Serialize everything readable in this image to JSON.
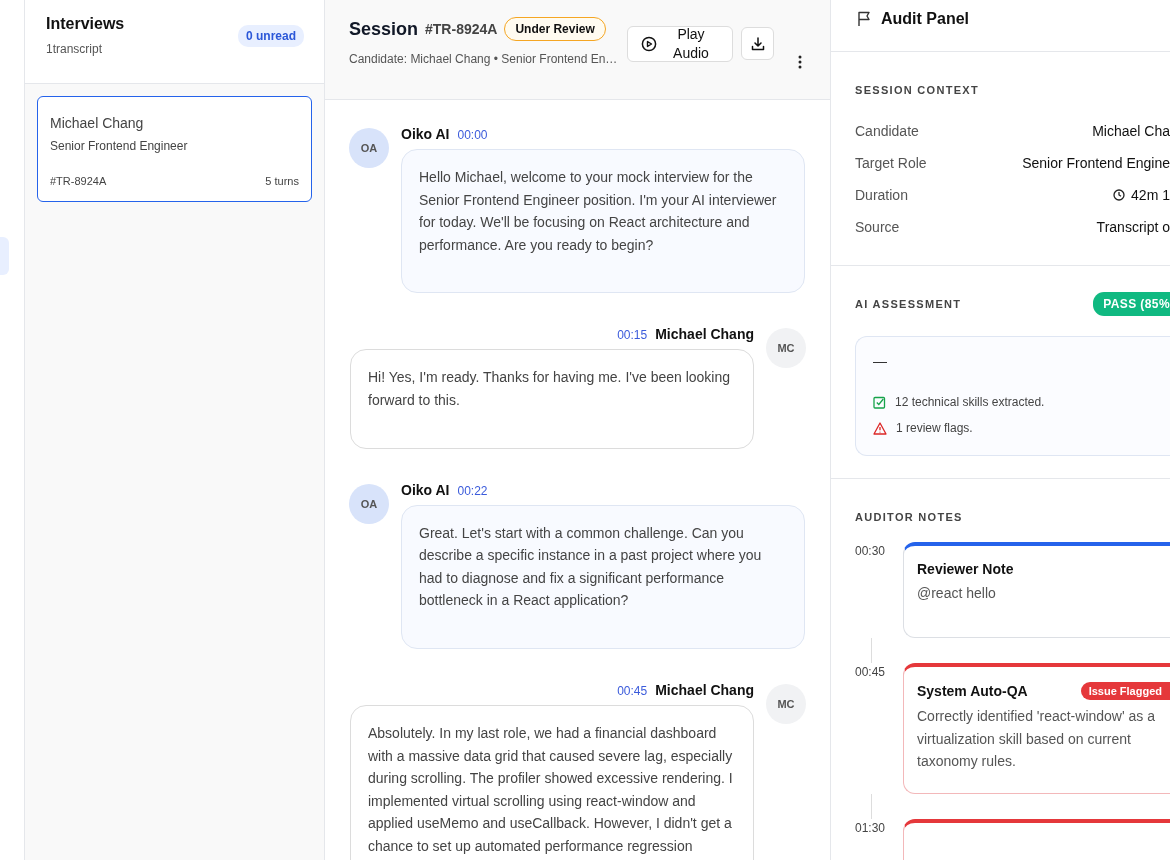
{
  "sidebar": {
    "title": "Interviews",
    "subtitle": "1transcript",
    "unread": "0 unread",
    "items": [
      {
        "name": "Michael Chang",
        "role": "Senior Frontend Engineer",
        "id": "#TR-8924A",
        "turns": "5 turns",
        "selected": true
      }
    ]
  },
  "session": {
    "title": "Session",
    "id": "#TR-8924A",
    "status": "Under Review",
    "subtitle": "Candidate: Michael Chang • Senior Frontend En…",
    "play_button": "Play Audio"
  },
  "messages": [
    {
      "kind": "ai",
      "speaker": "Oiko AI",
      "time": "00:00",
      "initials": "OA",
      "text": "Hello Michael, welcome to your mock interview for the Senior Frontend Engineer position. I'm your AI interviewer for today. We'll be focusing on React architecture and performance. Are you ready to begin?"
    },
    {
      "kind": "candidate",
      "speaker": "Michael Chang",
      "time": "00:15",
      "initials": "MC",
      "text": "Hi! Yes, I'm ready. Thanks for having me. I've been looking forward to this."
    },
    {
      "kind": "ai",
      "speaker": "Oiko AI",
      "time": "00:22",
      "initials": "OA",
      "text": "Great. Let's start with a common challenge. Can you describe a specific instance in a past project where you had to diagnose and fix a significant performance bottleneck in a React application?"
    },
    {
      "kind": "candidate",
      "speaker": "Michael Chang",
      "time": "00:45",
      "initials": "MC",
      "text": "Absolutely. In my last role, we had a financial dashboard with a massive data grid that caused severe lag, especially during scrolling. The profiler showed excessive rendering. I implemented virtual scrolling using react-window and applied useMemo and useCallback. However, I didn't get a chance to set up automated performance regression"
    }
  ],
  "audit": {
    "title": "Audit Panel",
    "context": {
      "title": "SESSION CONTEXT",
      "rows": [
        {
          "label": "Candidate",
          "value": "Michael Cha"
        },
        {
          "label": "Target Role",
          "value": "Senior Frontend Engine"
        },
        {
          "label": "Duration",
          "value": "42m 1",
          "kind": "time"
        },
        {
          "label": "Source",
          "value": "Transcript o"
        }
      ]
    },
    "assessment": {
      "title": "AI ASSESSMENT",
      "result": "PASS (85%",
      "summary": "—",
      "items": [
        {
          "kind": "success",
          "text": "12 technical skills extracted."
        },
        {
          "kind": "warning",
          "text": "1 review flags."
        }
      ]
    },
    "notes": {
      "title": "AUDITOR NOTES",
      "items": [
        {
          "kind": "reviewer",
          "time": "00:30",
          "title": "Reviewer Note",
          "text": "@react hello"
        },
        {
          "kind": "system",
          "time": "00:45",
          "title": "System Auto-QA",
          "badge": "Issue Flagged",
          "text": "Correctly identified 'react-window' as a virtualization skill based on current taxonomy rules."
        },
        {
          "kind": "system",
          "time": "01:30"
        }
      ]
    }
  }
}
